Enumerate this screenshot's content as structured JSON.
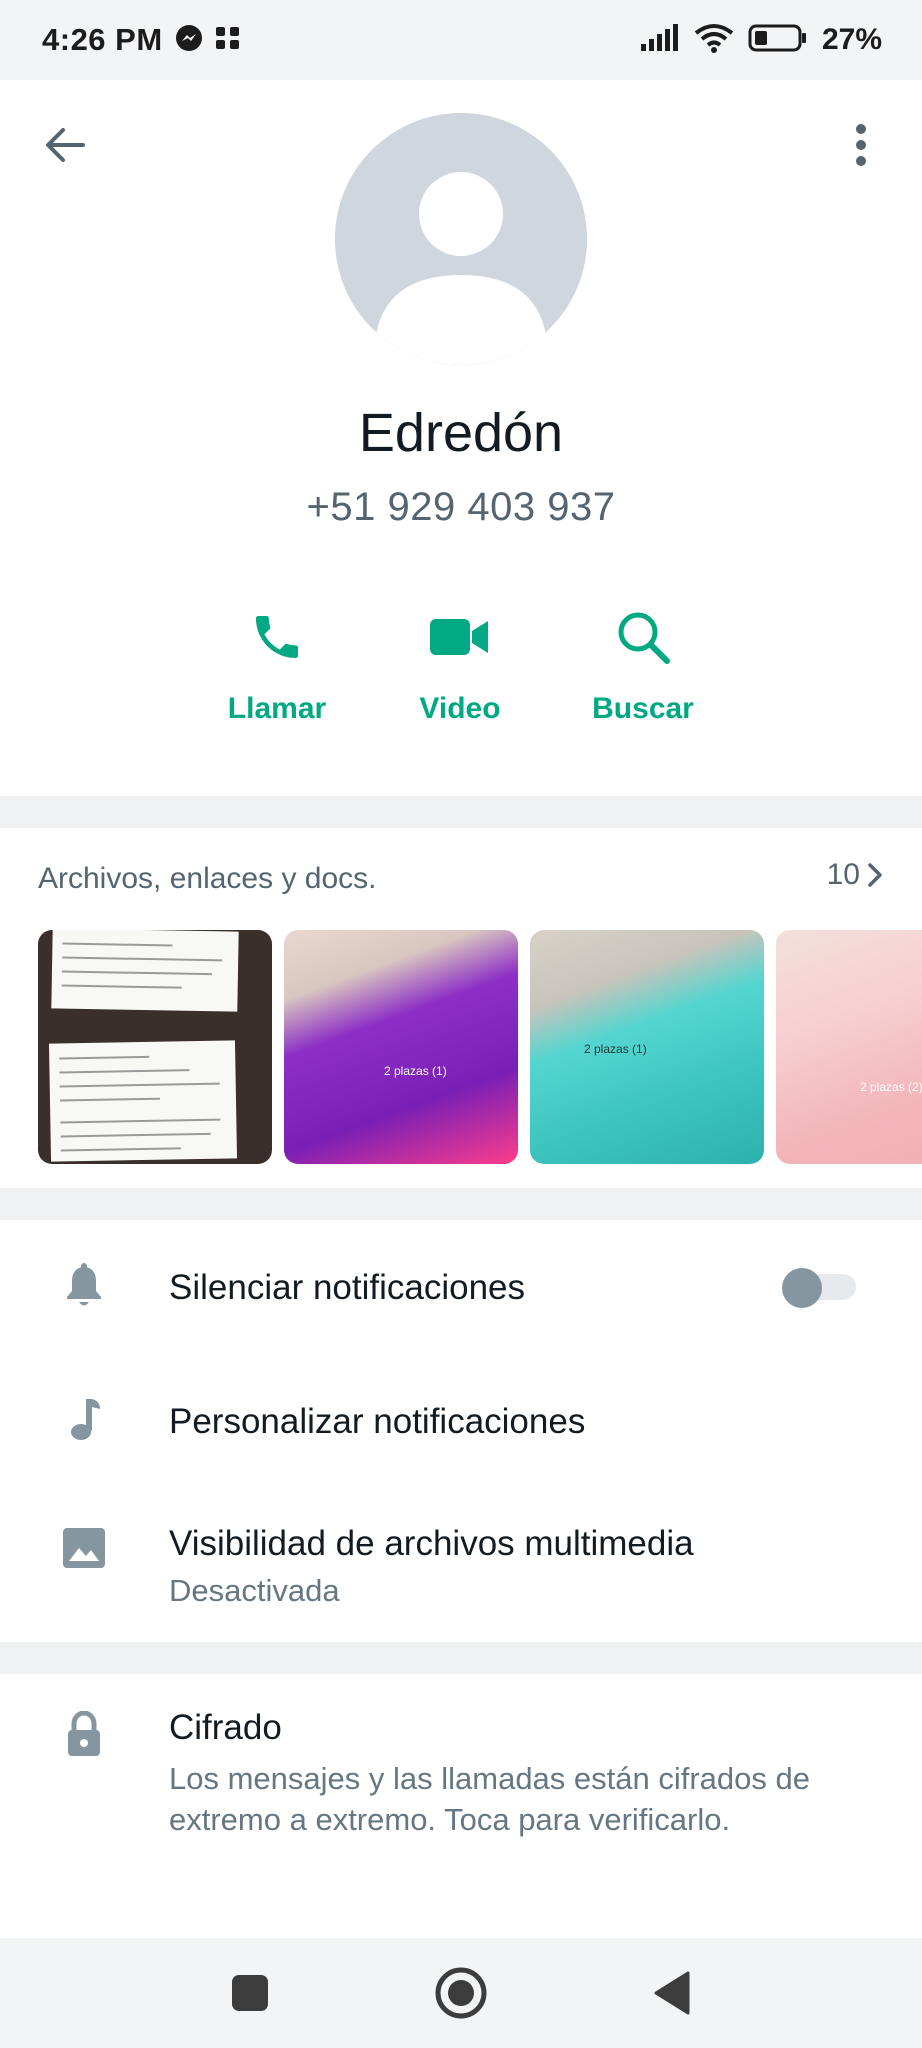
{
  "status_bar": {
    "time": "4:26 PM",
    "battery": "27%"
  },
  "contact": {
    "name": "Edredón",
    "phone": "+51 929 403 937"
  },
  "actions": [
    {
      "label": "Llamar",
      "icon": "phone-icon"
    },
    {
      "label": "Video",
      "icon": "video-camera-icon"
    },
    {
      "label": "Buscar",
      "icon": "search-icon"
    }
  ],
  "media": {
    "title": "Archivos, enlaces y docs.",
    "count": "10",
    "thumbnails": [
      {
        "caption": ""
      },
      {
        "caption": "2 plazas (1)"
      },
      {
        "caption": "2 plazas (1)"
      },
      {
        "caption": "2 plazas (2)"
      }
    ]
  },
  "settings": {
    "mute": {
      "label": "Silenciar notificaciones",
      "enabled": false
    },
    "custom": {
      "label": "Personalizar notificaciones"
    },
    "media_visibility": {
      "label": "Visibilidad de archivos multimedia",
      "value": "Desactivada"
    }
  },
  "encryption": {
    "title": "Cifrado",
    "description": "Los mensajes y las llamadas están cifrados de extremo a extremo. Toca para verificarlo."
  },
  "colors": {
    "accent": "#00a884",
    "icon_gray": "#8696a0",
    "text_secondary": "#667781"
  }
}
